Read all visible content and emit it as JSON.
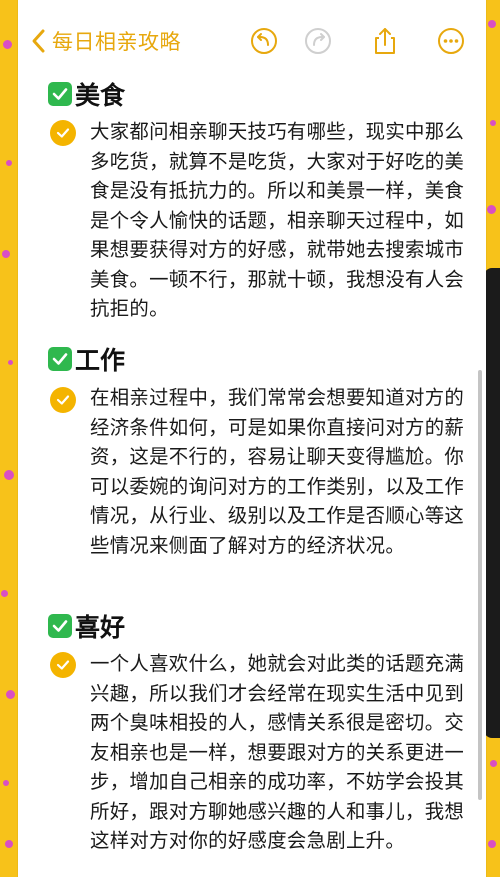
{
  "header": {
    "back_label": "每日相亲攻略",
    "icons": [
      "chevron-left-icon",
      "undo-icon",
      "redo-icon",
      "share-icon",
      "more-icon"
    ]
  },
  "sections": [
    {
      "title": "美食",
      "text": "大家都问相亲聊天技巧有哪些，现实中那么多吃货，就算不是吃货，大家对于好吃的美食是没有抵抗力的。所以和美景一样，美食是个令人愉快的话题，相亲聊天过程中，如果想要获得对方的好感，就带她去搜索城市美食。一顿不行，那就十顿，我想没有人会抗拒的。"
    },
    {
      "title": "工作",
      "text": "在相亲过程中，我们常常会想要知道对方的经济条件如何，可是如果你直接问对方的薪资，这是不行的，容易让聊天变得尴尬。你可以委婉的询问对方的工作类别，以及工作情况，从行业、级别以及工作是否顺心等这些情况来侧面了解对方的经济状况。"
    },
    {
      "title": "喜好",
      "text": "一个人喜欢什么，她就会对此类的话题充满兴趣，所以我们才会经常在现实生活中见到两个臭味相投的人，感情关系很是密切。交友相亲也是一样，想要跟对方的关系更进一步，增加自己相亲的成功率，不妨学会投其所好，跟对方聊她感兴趣的人和事儿，我想这样对方对你的好感度会急剧上升。"
    }
  ],
  "colors": {
    "accent": "#e7a80e",
    "bullet": "#f4b400",
    "checkbox": "#2fb84e",
    "background": "#f7c21a",
    "dots": "#d94fc4"
  }
}
